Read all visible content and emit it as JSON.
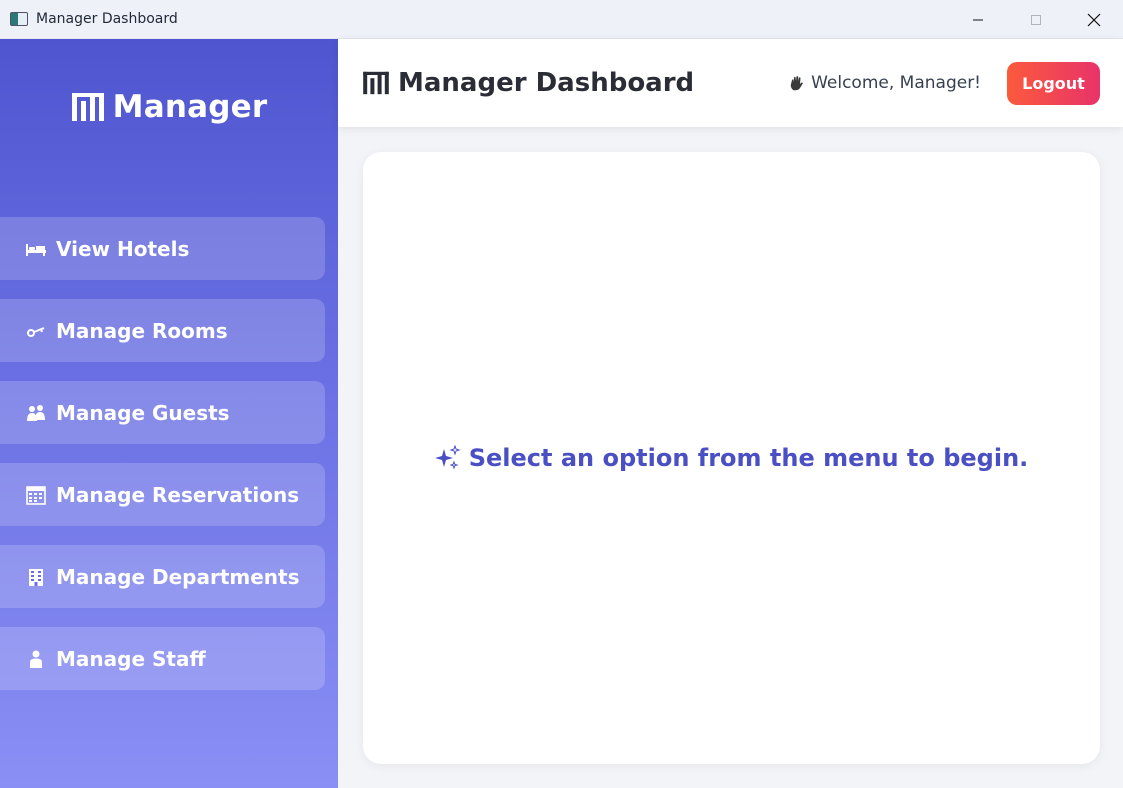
{
  "window": {
    "title": "Manager Dashboard",
    "icon": "app-window-icon",
    "controls": [
      "minimize-icon",
      "maximize-icon",
      "close-icon"
    ]
  },
  "sidebar": {
    "brand": {
      "icon": "bar-chart-icon",
      "text": "Manager"
    },
    "items": [
      {
        "label": "View Hotels",
        "icon": "bed-icon"
      },
      {
        "label": "Manage Rooms",
        "icon": "key-icon"
      },
      {
        "label": "Manage Guests",
        "icon": "people-icon"
      },
      {
        "label": "Manage Reservations",
        "icon": "calendar-icon"
      },
      {
        "label": "Manage Departments",
        "icon": "office-building-icon"
      },
      {
        "label": "Manage Staff",
        "icon": "person-icon"
      }
    ]
  },
  "header": {
    "title": "Manager Dashboard",
    "title_icon": "bar-chart-icon",
    "welcome_icon": "waving-hand-icon",
    "welcome_text": "Welcome, Manager!",
    "logout_label": "Logout"
  },
  "main": {
    "prompt_icon": "sparkles-icon",
    "prompt": "Select an option from the menu to begin."
  },
  "colors": {
    "sidebar_top": "#4f55cf",
    "sidebar_bottom": "#8a8ff5",
    "accent_text": "#4a4fc4",
    "logout_start": "#fb5a3c",
    "logout_end": "#e8336a"
  }
}
